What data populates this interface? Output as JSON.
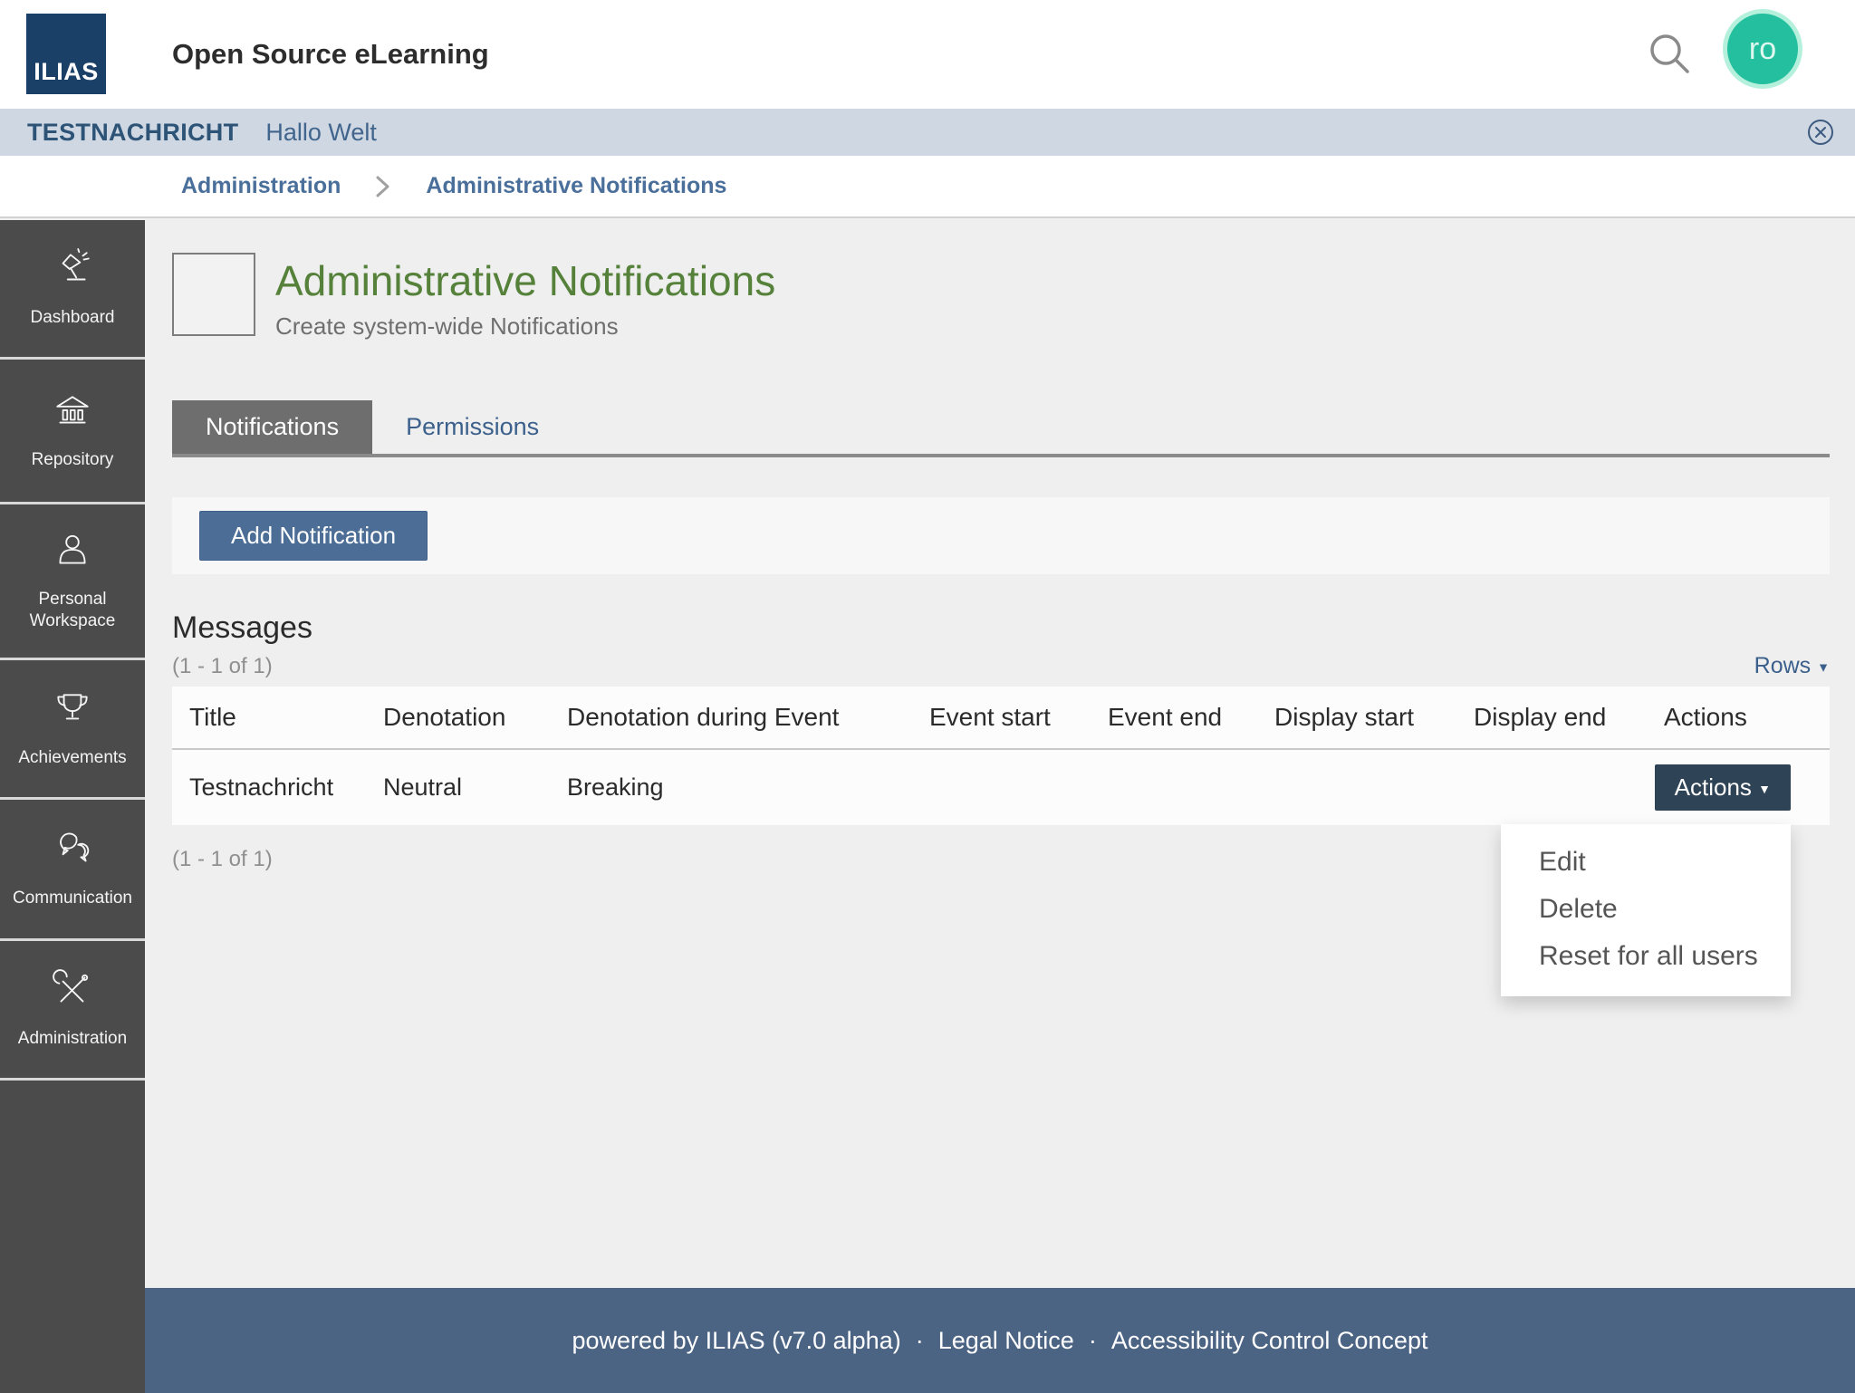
{
  "header": {
    "logo_text": "ILIAS",
    "app_title": "Open Source eLearning",
    "avatar_initials": "ro"
  },
  "notification_banner": {
    "title": "TESTNACHRICHT",
    "message": "Hallo Welt"
  },
  "breadcrumb": {
    "items": [
      "Administration",
      "Administrative Notifications"
    ]
  },
  "sidebar": {
    "items": [
      {
        "label": "Dashboard",
        "icon": "desk-lamp-icon"
      },
      {
        "label": "Repository",
        "icon": "bank-building-icon"
      },
      {
        "label": "Personal Workspace",
        "icon": "person-icon"
      },
      {
        "label": "Achievements",
        "icon": "trophy-icon"
      },
      {
        "label": "Communication",
        "icon": "speech-bubbles-icon"
      },
      {
        "label": "Administration",
        "icon": "tools-icon"
      }
    ]
  },
  "main": {
    "page_title": "Administrative Notifications",
    "page_subtitle": "Create system-wide Notifications",
    "tabs": [
      {
        "label": "Notifications",
        "active": true
      },
      {
        "label": "Permissions",
        "active": false
      }
    ],
    "toolbar": {
      "add_button_label": "Add Notification"
    },
    "messages": {
      "heading": "Messages",
      "range_top": "(1 - 1 of 1)",
      "rows_dropdown_label": "Rows",
      "columns": [
        "Title",
        "Denotation",
        "Denotation during Event",
        "Event start",
        "Event end",
        "Display start",
        "Display end",
        "Actions"
      ],
      "rows": [
        {
          "title": "Testnachricht",
          "denotation": "Neutral",
          "denotation_during_event": "Breaking",
          "event_start": "",
          "event_end": "",
          "display_start": "",
          "display_end": "",
          "actions_button_label": "Actions"
        }
      ],
      "range_bottom": "(1 - 1 of 1)"
    },
    "actions_menu": {
      "items": [
        "Edit",
        "Delete",
        "Reset for all users"
      ]
    }
  },
  "footer": {
    "powered_by": "powered by ILIAS (v7.0 alpha)",
    "separator": "·",
    "links": [
      "Legal Notice",
      "Accessibility Control Concept"
    ]
  },
  "colors": {
    "logo_background": "#1a4067",
    "banner_background": "#cfd7e3",
    "sidebar_background": "#4b4b4b",
    "page_background": "#efefef",
    "page_title_green": "#55813a",
    "active_tab_gray": "#6e6e6e",
    "link_blue": "#4a6f9b",
    "primary_button_blue": "#4c6e96",
    "actions_button_navy": "#2e4356",
    "footer_blue": "#4c6484",
    "avatar_teal": "#23bf9e"
  }
}
